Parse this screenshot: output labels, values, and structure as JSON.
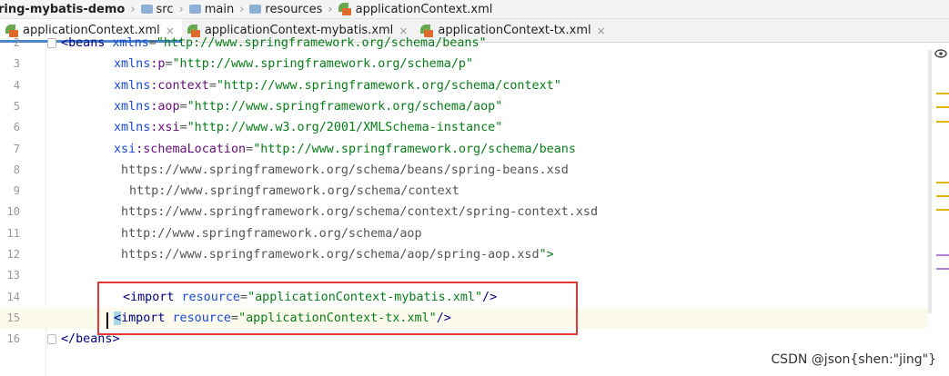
{
  "breadcrumb": [
    {
      "label": "ring-mybatis-demo",
      "icon": "module-folder-icon"
    },
    {
      "label": "src",
      "icon": "folder-icon"
    },
    {
      "label": "main",
      "icon": "folder-icon"
    },
    {
      "label": "resources",
      "icon": "folder-icon"
    },
    {
      "label": "applicationContext.xml",
      "icon": "spring-xml-icon"
    }
  ],
  "tabs": [
    {
      "label": "applicationContext.xml",
      "active": true
    },
    {
      "label": "applicationContext-mybatis.xml",
      "active": false
    },
    {
      "label": "applicationContext-tx.xml",
      "active": false
    }
  ],
  "close_glyph": "×",
  "lines": [
    {
      "n": "2",
      "fold": true,
      "html": "beans_open"
    },
    {
      "n": "3",
      "text": "xmlns:p=\"http://www.springframework.org/schema/p\""
    },
    {
      "n": "4",
      "text": "xmlns:context=\"http://www.springframework.org/schema/context\""
    },
    {
      "n": "5",
      "text": "xmlns:aop=\"http://www.springframework.org/schema/aop\""
    },
    {
      "n": "6",
      "text": "xmlns:xsi=\"http://www.w3.org/2001/XMLSchema-instance\""
    },
    {
      "n": "7",
      "text": "xsi:schemaLocation=\"http://www.springframework.org/schema/beans"
    },
    {
      "n": "8",
      "text": "https://www.springframework.org/schema/beans/spring-beans.xsd"
    },
    {
      "n": "9",
      "text": "http://www.springframework.org/schema/context"
    },
    {
      "n": "10",
      "text": "https://www.springframework.org/schema/context/spring-context.xsd"
    },
    {
      "n": "11",
      "text": "http://www.springframework.org/schema/aop"
    },
    {
      "n": "12",
      "text": "https://www.springframework.org/schema/aop/spring-aop.xsd\">"
    },
    {
      "n": "13",
      "text": ""
    },
    {
      "n": "14",
      "text": "<import resource=\"applicationContext-mybatis.xml\"/>"
    },
    {
      "n": "15",
      "text": "<import resource=\"applicationContext-tx.xml\"/>"
    },
    {
      "n": "16",
      "text": "</beans>"
    }
  ],
  "line2_text": "<beans xmlns=\"http://www.springframework.org/schema/beans\"",
  "watermark": "CSDN @json{shen:\"jing\"}",
  "colors": {
    "tag": "#000080",
    "attr": "#174ad4",
    "string": "#067d17",
    "namespace": "#660e7a",
    "highlight_box": "#e53935",
    "tab_underline": "#4a86c8"
  }
}
